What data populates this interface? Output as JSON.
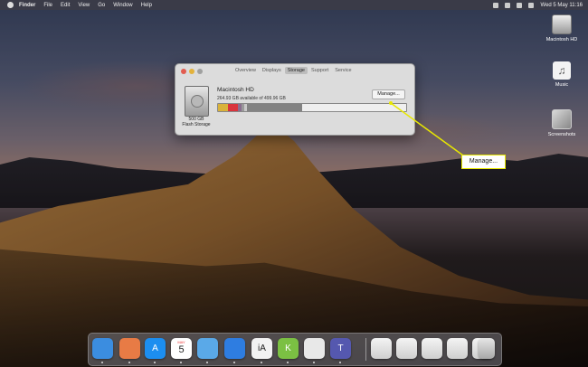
{
  "menubar": {
    "items": [
      "Finder",
      "File",
      "Edit",
      "View",
      "Go",
      "Window",
      "Help"
    ],
    "clock": "Wed 5 May  11:16"
  },
  "desktop_icons": [
    {
      "label": "Macintosh HD",
      "icon": "hard-drive-icon"
    },
    {
      "label": "Music",
      "icon": "music-note-icon"
    },
    {
      "label": "Screenshots",
      "icon": "folder-image-icon"
    }
  ],
  "window": {
    "tabs": [
      "Overview",
      "Displays",
      "Storage",
      "Support",
      "Service"
    ],
    "active_tab": "Storage",
    "disk_name": "Macintosh HD",
    "disk_available": "264.93 GB available of 499.96 GB",
    "disk_capacity": "500 GB",
    "disk_type": "Flash Storage",
    "manage_label": "Manage...",
    "storage_segments": [
      {
        "name": "segment-1",
        "color": "#d9b23a",
        "fraction": 0.055
      },
      {
        "name": "segment-2",
        "color": "#d9343c",
        "fraction": 0.05
      },
      {
        "name": "segment-3",
        "color": "#8a6d8f",
        "fraction": 0.02
      },
      {
        "name": "segment-4",
        "color": "#9a9a9a",
        "fraction": 0.015
      },
      {
        "name": "segment-5",
        "color": "#c9c9c9",
        "fraction": 0.015
      },
      {
        "name": "segment-6",
        "color": "#838383",
        "fraction": 0.29
      }
    ]
  },
  "callout": {
    "label": "Manage...",
    "color": "#e8e800"
  },
  "dock": {
    "calendar_month": "MAY",
    "calendar_day": "5",
    "apps": [
      {
        "icon": "finder-icon",
        "color": "#3b8de0",
        "glyph": ""
      },
      {
        "icon": "launchpad-icon",
        "color": "#e87b45",
        "glyph": ""
      },
      {
        "icon": "app-store-icon",
        "color": "#1c8ef0",
        "glyph": "A"
      },
      {
        "icon": "calendar-icon",
        "color": "#ffffff",
        "glyph": ""
      },
      {
        "icon": "mail-icon",
        "color": "#5aa9e8",
        "glyph": ""
      },
      {
        "icon": "safari-icon",
        "color": "#2e7de1",
        "glyph": ""
      },
      {
        "icon": "ia-writer-icon",
        "color": "#f2f2f2",
        "glyph": "iA"
      },
      {
        "icon": "kite-icon",
        "color": "#7bc043",
        "glyph": "K"
      },
      {
        "icon": "textedit-icon",
        "color": "#e8e8e8",
        "glyph": ""
      },
      {
        "icon": "teams-icon",
        "color": "#5558af",
        "glyph": "T"
      }
    ],
    "minimized": [
      "minimized-window-1",
      "minimized-window-2",
      "minimized-window-3",
      "minimized-window-4",
      "minimized-window-5"
    ],
    "trash_icon": "trash-icon"
  }
}
